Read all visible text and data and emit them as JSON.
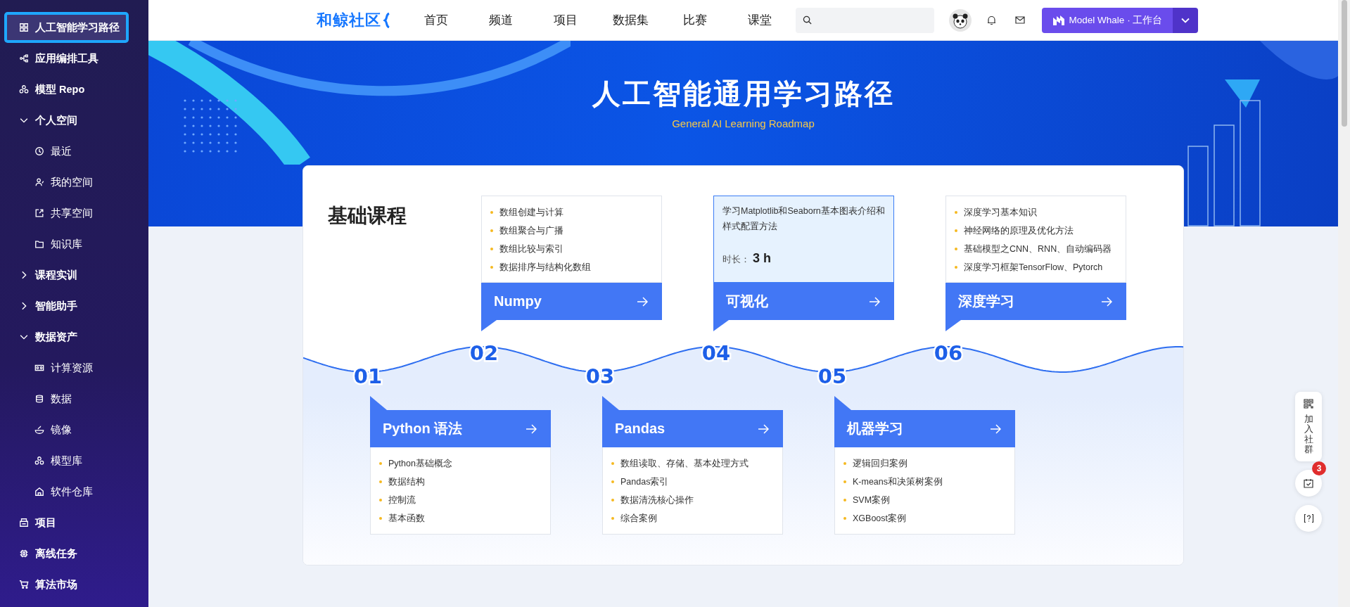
{
  "sidebar": {
    "items": [
      {
        "label": "人工智能学习路径",
        "selected": true
      },
      {
        "label": "应用编排工具",
        "selected": false
      },
      {
        "label": "模型 Repo",
        "selected": false
      },
      {
        "label": "个人空间",
        "selected": false,
        "expanded": true,
        "children": [
          {
            "label": "最近",
            "selected": false
          },
          {
            "label": "我的空间",
            "selected": false
          },
          {
            "label": "共享空间",
            "selected": false
          },
          {
            "label": "知识库",
            "selected": false
          }
        ]
      },
      {
        "label": "课程实训",
        "selected": false,
        "expanded": false
      },
      {
        "label": "智能助手",
        "selected": false,
        "expanded": false
      },
      {
        "label": "数据资产",
        "selected": false,
        "expanded": true,
        "children": [
          {
            "label": "计算资源",
            "selected": false
          },
          {
            "label": "数据",
            "selected": false
          },
          {
            "label": "镜像",
            "selected": false
          },
          {
            "label": "模型库",
            "selected": false
          },
          {
            "label": "软件仓库",
            "selected": false
          }
        ]
      },
      {
        "label": "项目",
        "selected": false
      },
      {
        "label": "离线任务",
        "selected": false
      },
      {
        "label": "算法市场",
        "selected": false
      }
    ]
  },
  "top_nav": {
    "logo": "和鲸社区",
    "links": [
      "首页",
      "频道",
      "项目",
      "数据集",
      "比赛",
      "课堂"
    ],
    "workbench_button": "Model Whale · 工作台"
  },
  "banner": {
    "title": "人工智能通用学习路径",
    "subtitle": "General AI Learning Roadmap"
  },
  "roadmap": {
    "heading": "基础课程",
    "courses": [
      {
        "number": "01",
        "title": "Python 语法",
        "kind": "list",
        "highlighted": false,
        "topics": [
          "Python基础概念",
          "数据结构",
          "控制流",
          "基本函数"
        ]
      },
      {
        "number": "02",
        "title": "Numpy",
        "kind": "list",
        "highlighted": false,
        "topics": [
          "数组创建与计算",
          "数组聚合与广播",
          "数组比较与索引",
          "数据排序与结构化数组"
        ]
      },
      {
        "number": "03",
        "title": "Pandas",
        "kind": "list",
        "highlighted": false,
        "topics": [
          "数组读取、存储、基本处理方式",
          "Pandas索引",
          "数据清洗核心操作",
          "综合案例"
        ]
      },
      {
        "number": "04",
        "title": "可视化",
        "kind": "text",
        "highlighted": true,
        "description": "学习Matplotlib和Seaborn基本图表介绍和样式配置方法",
        "duration_label": "时长：",
        "duration": "3 h"
      },
      {
        "number": "05",
        "title": "机器学习",
        "kind": "list",
        "highlighted": false,
        "topics": [
          "逻辑回归案例",
          "K-means和决策树案例",
          "SVM案例",
          "XGBoost案例"
        ]
      },
      {
        "number": "06",
        "title": "深度学习",
        "kind": "list",
        "highlighted": false,
        "topics": [
          "深度学习基本知识",
          "神经网络的原理及优化方法",
          "基础模型之CNN、RNN、自动编码器",
          "深度学习框架TensorFlow、Pytorch"
        ]
      }
    ]
  },
  "side_widgets": {
    "join_label": "加入社群",
    "notification_count": "3"
  }
}
